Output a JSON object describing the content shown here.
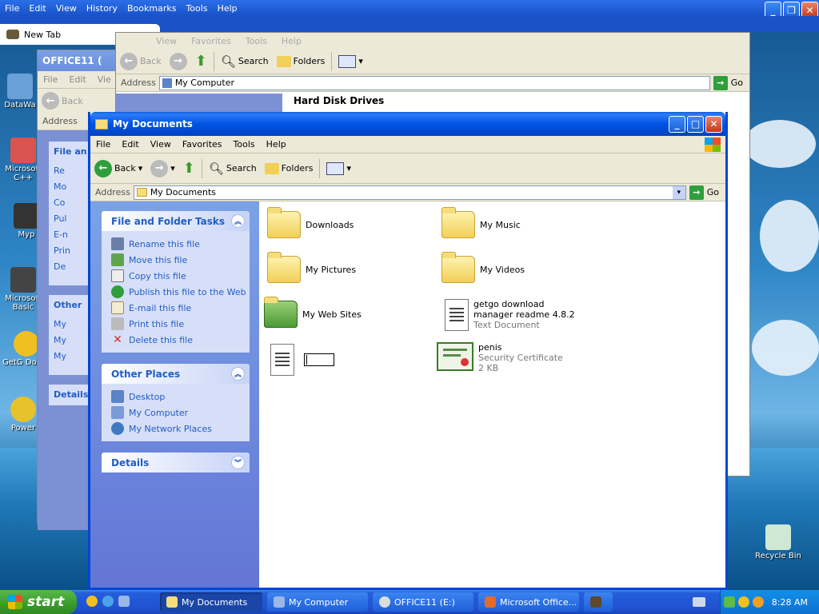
{
  "browser": {
    "menu": [
      "File",
      "Edit",
      "View",
      "History",
      "Bookmarks",
      "Tools",
      "Help"
    ],
    "tab": "New Tab",
    "menu_ghost": [
      "View",
      "Favorites",
      "Tools",
      "Help"
    ]
  },
  "desktop_icons": [
    {
      "label": "DataWa"
    },
    {
      "label": "Microsoft C++"
    },
    {
      "label": "Myp"
    },
    {
      "label": "Microsoft Basic"
    },
    {
      "label": "GetG Downl"
    },
    {
      "label": "Power"
    },
    {
      "label": "Recycle Bin"
    }
  ],
  "office_window": {
    "title": "OFFICE11 (",
    "menu": [
      "File",
      "Edit",
      "Vie"
    ],
    "back": "Back",
    "address_label": "Address",
    "panel_items": [
      "File an",
      "Other",
      "Details"
    ],
    "list": [
      "Re",
      "Mo",
      "Co",
      "Pul",
      "E-n",
      "Prin",
      "De"
    ],
    "other": [
      "My",
      "My",
      "My"
    ]
  },
  "mycomputer_window": {
    "back": "Back",
    "search": "Search",
    "folders": "Folders",
    "address_label": "Address",
    "address": "My Computer",
    "go": "Go",
    "heading": "Hard Disk Drives"
  },
  "main_window": {
    "title": "My Documents",
    "menu": [
      "File",
      "Edit",
      "View",
      "Favorites",
      "Tools",
      "Help"
    ],
    "toolbar": {
      "back": "Back",
      "search": "Search",
      "folders": "Folders"
    },
    "address_label": "Address",
    "address": "My Documents",
    "go": "Go",
    "tasks_title": "File and Folder Tasks",
    "tasks": [
      "Rename this file",
      "Move this file",
      "Copy this file",
      "Publish this file to the Web",
      "E-mail this file",
      "Print this file",
      "Delete this file"
    ],
    "other_title": "Other Places",
    "other": [
      "Desktop",
      "My Computer",
      "My Network Places"
    ],
    "details_title": "Details",
    "files": [
      {
        "name": "Downloads"
      },
      {
        "name": "My Music"
      },
      {
        "name": "My Pictures"
      },
      {
        "name": "My Videos"
      },
      {
        "name": "My Web Sites"
      },
      {
        "name": "getgo download manager readme 4.8.2",
        "type": "Text Document"
      },
      {
        "name": "",
        "type": ""
      },
      {
        "name": "penis",
        "type": "Security Certificate",
        "size": "2 KB"
      }
    ]
  },
  "taskbar": {
    "start": "start",
    "buttons": [
      "My Documents",
      "My Computer",
      "OFFICE11 (E:)",
      "Microsoft Office..."
    ],
    "clock": "8:28 AM"
  },
  "colors": {
    "xp_blue": "#0054e3",
    "task_green": "#3a9a2b",
    "link": "#215dc6"
  }
}
